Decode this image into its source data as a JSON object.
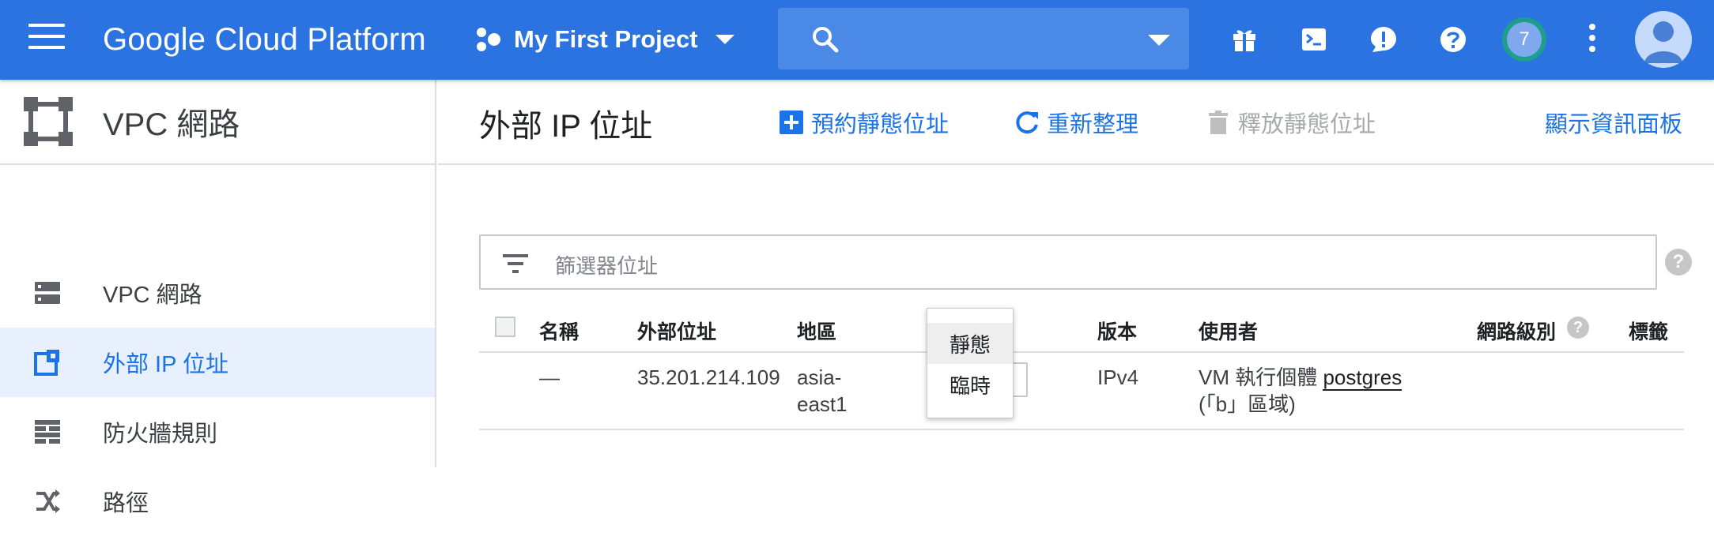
{
  "topbar": {
    "brand": "Google Cloud Platform",
    "project_name": "My First Project",
    "notification_count": "7"
  },
  "sidebar": {
    "title": "VPC 網路",
    "items": [
      {
        "label": "VPC 網路",
        "icon": "vpc-network-icon"
      },
      {
        "label": "外部 IP 位址",
        "icon": "external-ip-icon",
        "active": true
      },
      {
        "label": "防火牆規則",
        "icon": "firewall-icon"
      },
      {
        "label": "路徑",
        "icon": "routes-icon"
      }
    ]
  },
  "main": {
    "title": "外部 IP 位址",
    "actions": {
      "reserve": "預約靜態位址",
      "refresh": "重新整理",
      "release": "釋放靜態位址",
      "info_panel": "顯示資訊面板"
    },
    "filter_placeholder": "篩選器位址",
    "table": {
      "headers": {
        "name": "名稱",
        "external_address": "外部位址",
        "region": "地區",
        "version": "版本",
        "used_by": "使用者",
        "network_tier": "網路級別",
        "labels": "標籤"
      },
      "rows": [
        {
          "name": "—",
          "external_address": "35.201.214.109",
          "region_line1": "asia-",
          "region_line2": "east1",
          "version": "IPv4",
          "used_by_prefix": "VM 執行個體",
          "used_by_link": "postgres",
          "used_by_suffix": "(「b」區域)"
        }
      ]
    },
    "type_dropdown": {
      "options": [
        "靜態",
        "臨時"
      ],
      "highlighted": "靜態"
    }
  },
  "colors": {
    "topbar": "#2a73e0",
    "accent": "#1a73e8",
    "active_bg": "#e8f0fe"
  }
}
